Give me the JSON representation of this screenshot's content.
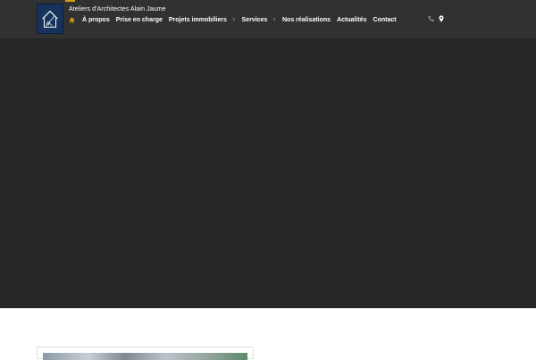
{
  "site": {
    "title": "Ateliers d'Architectes Alain Jaume"
  },
  "nav": {
    "items": [
      {
        "label": "À propos",
        "dropdown": false
      },
      {
        "label": "Prise en charge",
        "dropdown": false
      },
      {
        "label": "Projets immobiliers",
        "dropdown": true
      },
      {
        "label": "Services",
        "dropdown": true
      },
      {
        "label": "Nos réalisations",
        "dropdown": false
      },
      {
        "label": "Actualités",
        "dropdown": false
      },
      {
        "label": "Contact",
        "dropdown": false
      }
    ],
    "caret_glyph": "∨"
  },
  "icons": {
    "home": "home-icon",
    "phone": "phone-icon",
    "location": "map-pin-icon",
    "logo": "house-logo-icon"
  },
  "colors": {
    "header_bg": "#313131",
    "hero_bg": "#272727",
    "accent": "#d4a017",
    "logo_bg": "#17325c",
    "text": "#ffffff",
    "muted": "#9a9a9a"
  }
}
